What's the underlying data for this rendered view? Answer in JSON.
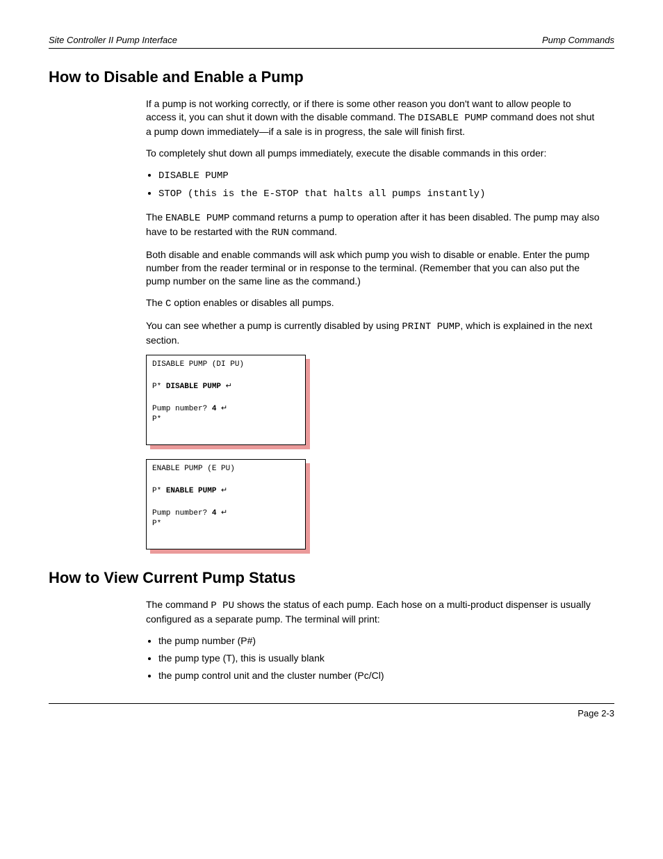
{
  "header": {
    "left": "Site Controller II Pump Interface",
    "right": "Pump Commands"
  },
  "footer": {
    "text": "Page 2-3"
  },
  "sec1": {
    "title": "How to Disable and Enable a Pump",
    "intro_a": "If a pump is not working correctly, or if there is some other reason you don't want to allow people to access it, you can shut it down with the disable command. The ",
    "intro_cmd": "DISABLE PUMP",
    "intro_b": " command does not shut a pump down immediately—if a sale is in progress, the sale will finish first.",
    "p2": "To completely shut down all pumps immediately, execute the disable commands in this order:",
    "bullets": [
      "DISABLE PUMP",
      "STOP (this is the E-STOP that halts all pumps instantly)"
    ],
    "p3a": "The ",
    "p3cmd1": "ENABLE PUMP",
    "p3b": " command returns a pump to operation after it has been disabled. The pump may also have to be restarted with the ",
    "p3cmd2": "RUN",
    "p3c": " command.",
    "p4": "Both disable and enable commands will ask which pump you wish to disable or enable. Enter the pump number from the reader terminal or in response to the terminal. (Remember that you can also put the pump number on the same line as the command.)",
    "p5a": "The ",
    "p5cmd": "C",
    "p5b": " option enables or disables all pumps.",
    "p6a": "You can see whether a pump is currently disabled by using ",
    "p6cmd": "PRINT PUMP",
    "p6b": ", which is explained in the next section."
  },
  "code1": {
    "l1": "DISABLE PUMP (DI PU)",
    "l2a": "P* ",
    "l2b": "DISABLE PUMP",
    "l3": "Pump number? ",
    "l3b": "4",
    "l4": "P*"
  },
  "code2": {
    "l1": "ENABLE PUMP (E PU)",
    "l2a": "P* ",
    "l2b": "ENABLE PUMP",
    "l3": "Pump number? ",
    "l3b": "4",
    "l4": "P*"
  },
  "sec2": {
    "title": "How to View Current Pump Status",
    "p1a": "The command ",
    "p1cmd": "P PU",
    "p1b": " shows the status of each pump. Each hose on a multi-product dispenser is usually configured as a separate pump. The terminal will print:",
    "bullets": [
      "the pump number (P#)",
      "the pump type (T), this is usually blank",
      "the pump control unit and the cluster number (Pc/Cl)"
    ]
  }
}
